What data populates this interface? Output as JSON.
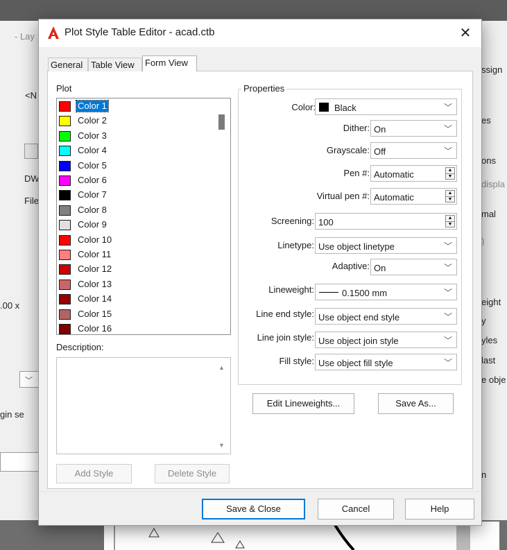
{
  "background": {
    "top_left_fragment": "- Lay",
    "left_fragments": [
      "<N",
      "DW",
      "File",
      ".00 x",
      "gin se"
    ],
    "right_fragments": [
      "ssign",
      "es",
      "ons",
      "displa",
      "mal",
      ")",
      "eight",
      "y",
      "yles",
      "last",
      "e obje",
      "n"
    ]
  },
  "dialog": {
    "title": "Plot Style Table Editor - acad.ctb",
    "close_glyph": "✕",
    "logo_glyph": "A",
    "tabs": [
      {
        "label": "General"
      },
      {
        "label": "Table View"
      },
      {
        "label": "Form View"
      }
    ],
    "active_tab": "Form View"
  },
  "plot": {
    "label": "Plot",
    "items": [
      {
        "name": "Color 1",
        "color": "#ff0000",
        "selected": true
      },
      {
        "name": "Color 2",
        "color": "#ffff00"
      },
      {
        "name": "Color 3",
        "color": "#00ff00"
      },
      {
        "name": "Color 4",
        "color": "#00ffff"
      },
      {
        "name": "Color 5",
        "color": "#0000ff"
      },
      {
        "name": "Color 6",
        "color": "#ff00ff"
      },
      {
        "name": "Color 7",
        "color": "#000000"
      },
      {
        "name": "Color 8",
        "color": "#808080"
      },
      {
        "name": "Color 9",
        "color": "#e0e0e0"
      },
      {
        "name": "Color 10",
        "color": "#ff0000"
      },
      {
        "name": "Color 11",
        "color": "#ff7f7f"
      },
      {
        "name": "Color 12",
        "color": "#cc0000"
      },
      {
        "name": "Color 13",
        "color": "#cc6666"
      },
      {
        "name": "Color 14",
        "color": "#990000"
      },
      {
        "name": "Color 15",
        "color": "#b26464"
      },
      {
        "name": "Color 16",
        "color": "#7f0000"
      }
    ]
  },
  "description": {
    "label": "Description:"
  },
  "left_buttons": {
    "add_style": "Add Style",
    "delete_style": "Delete Style"
  },
  "properties": {
    "legend": "Properties",
    "color": {
      "label": "Color:",
      "value": "Black",
      "swatch": "#000000"
    },
    "dither": {
      "label": "Dither:",
      "value": "On"
    },
    "grayscale": {
      "label": "Grayscale:",
      "value": "Off"
    },
    "pen": {
      "label": "Pen #:",
      "value": "Automatic"
    },
    "virtual_pen": {
      "label": "Virtual pen #:",
      "value": "Automatic"
    },
    "screening": {
      "label": "Screening:",
      "value": "100"
    },
    "linetype": {
      "label": "Linetype:",
      "value": "Use object linetype"
    },
    "adaptive": {
      "label": "Adaptive:",
      "value": "On"
    },
    "lineweight": {
      "label": "Lineweight:",
      "value": "0.1500 mm"
    },
    "line_end_style": {
      "label": "Line end style:",
      "value": "Use object end style"
    },
    "line_join_style": {
      "label": "Line join style:",
      "value": "Use object join style"
    },
    "fill_style": {
      "label": "Fill style:",
      "value": "Use object fill style"
    }
  },
  "props_buttons": {
    "edit_lineweights": "Edit Lineweights...",
    "save_as": "Save As..."
  },
  "footer_buttons": {
    "save_close": "Save & Close",
    "cancel": "Cancel",
    "help": "Help"
  },
  "colors": {
    "accent": "#0078d7",
    "logo_red": "#e2231a"
  }
}
